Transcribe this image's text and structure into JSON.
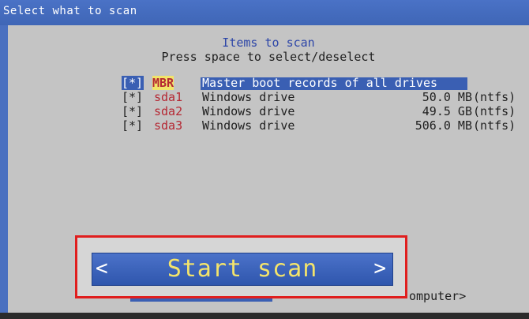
{
  "window": {
    "title": "Select what to scan"
  },
  "dialog": {
    "heading": "Items to scan",
    "instruction": "Press space to select/deselect"
  },
  "items": [
    {
      "checkbox": "[*]",
      "id": "MBR",
      "description": "Master boot records of all drives",
      "size": "",
      "fs": "",
      "selected": true
    },
    {
      "checkbox": "[*]",
      "id": "sda1",
      "description": "Windows drive",
      "size": "50.0 MB",
      "fs": "(ntfs)",
      "selected": false
    },
    {
      "checkbox": "[*]",
      "id": "sda2",
      "description": "Windows drive",
      "size": "49.5 GB",
      "fs": "(ntfs)",
      "selected": false
    },
    {
      "checkbox": "[*]",
      "id": "sda3",
      "description": "Windows drive",
      "size": "506.0 MB",
      "fs": "(ntfs)",
      "selected": false
    }
  ],
  "buttons": {
    "start_scan": {
      "label": "Start scan",
      "left": "<",
      "right": ">"
    },
    "computer_partial": "omputer>"
  },
  "colors": {
    "accent": "#3a5fb3",
    "highlight_box": "#e01e1e",
    "button_text": "#f4e46b",
    "item_id": "#b52833"
  }
}
